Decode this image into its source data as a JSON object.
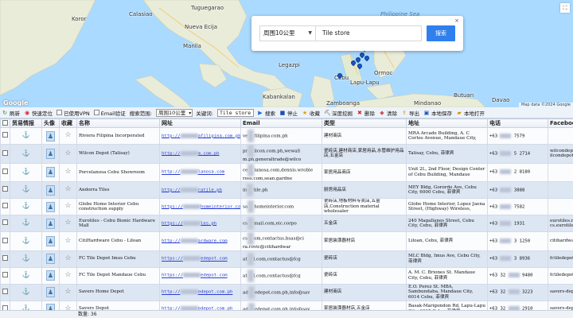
{
  "map": {
    "labels": [
      {
        "text": "Calasiao",
        "cls": ""
      },
      {
        "text": "Nueva Ecija",
        "cls": ""
      },
      {
        "text": "Tuguegarao",
        "cls": ""
      },
      {
        "text": "Philippine Sea",
        "cls": "sea"
      },
      {
        "text": "Manila",
        "cls": ""
      },
      {
        "text": "Legazpi",
        "cls": ""
      },
      {
        "text": "Ormoc",
        "cls": ""
      },
      {
        "text": "Cebu",
        "cls": ""
      },
      {
        "text": "Lapu-Lapu",
        "cls": ""
      },
      {
        "text": "Kabankalan",
        "cls": ""
      },
      {
        "text": "Butuan",
        "cls": ""
      },
      {
        "text": "Mindanao",
        "cls": ""
      },
      {
        "text": "Zamboanga",
        "cls": ""
      },
      {
        "text": "Davao",
        "cls": ""
      },
      {
        "text": "Koror",
        "cls": ""
      }
    ],
    "google_logo": "Google",
    "attribution": "Map data ©2024 Google"
  },
  "search_popup": {
    "radius": "周围10公里",
    "keyword": "Tile store",
    "search_button": "搜索",
    "close": "×"
  },
  "toolbar": {
    "refresh": "刷新",
    "quick_locate": "快速定位",
    "used_vpn": "已使用VPN",
    "email_verify": "Email验证",
    "search_range_label": "搜索范围:",
    "search_range_value": "周围10公里",
    "keyword_label": "关键词:",
    "keyword_value": "Tile store",
    "search": "搜索",
    "stop": "停止",
    "favorite": "收藏",
    "deep_dig": "深度挖掘",
    "delete": "删除",
    "clear": "清除",
    "export": "导出",
    "local_save": "本地保存",
    "local_open": "本地打开"
  },
  "table": {
    "headers": [
      "",
      "贸易情报",
      "头像",
      "收藏",
      "名称",
      "网址",
      "Email",
      "类型",
      "地址",
      "电话",
      "Facebook"
    ],
    "rows": [
      {
        "name": "Riviera Filipina Incorporated",
        "url_a": "http://",
        "url_b": "afilipina.com.ph",
        "email_a": "ve",
        "email_b": "filipina.com.ph",
        "type": "建材商店",
        "addr": "MRA Arcade Building, A. C Cortes Avenue, Mandaue City,",
        "ph_a": "+63",
        "ph_b": "7579",
        "fb": ""
      },
      {
        "name": "Wilcon Depot (Talisay)",
        "url_a": "http://",
        "url_b": "m.com.ph",
        "email_a": "pr",
        "email_b": "ilcon.com.ph,wewall m.ph,generaltrade@wilco",
        "type": "瓷砖店,建材商店,家居用品,水管维护用品店,五金店",
        "addr": "Talisay, Cebu, 菲律宾",
        "ph_a": "+63",
        "ph_b": "5 2714",
        "fb": "wilcondepot, ilcondepot"
      },
      {
        "name": "Porcelanosa Cebu Showroom",
        "url_a": "http://",
        "url_b": "lanosa.com",
        "email_a": "ce",
        "email_b": "lanosa.com,dennis.wroble ross.com,sean.gardne",
        "type": "家居用品商店",
        "addr": "Unit 2L, 2nd Floor, Design Center of Cebu Building, Mandaue",
        "ph_a": "+63",
        "ph_b": "2 8180",
        "fb": ""
      },
      {
        "name": "Andorra Tiles",
        "url_a": "http://",
        "url_b": "ratile.ph",
        "email_a": "in",
        "email_b": "tile.ph",
        "type": "厨房用品店",
        "addr": "MEY Bldg, Gorordo Ave, Cebu City, 6000 Cebu, 菲律宾",
        "ph_a": "+63",
        "ph_b": "3888",
        "fb": ""
      },
      {
        "name": "Globe Home Interior Cebu construction supply",
        "url_a": "https://",
        "url_b": "homeinterior.com",
        "email_a": "sa",
        "email_b": "homeinterior.com",
        "type": "瓷砖店,地板材料专卖店,五金店,Construction material wholesaler",
        "addr": "Globe Home Interior, Lopez Jaena Street, (Highway) Wireless,",
        "ph_a": "+63",
        "ph_b": "7582",
        "fb": ""
      },
      {
        "name": "Eurotiles - Cebu Bionic Hardware Mall",
        "url_a": "https://",
        "url_b": "les.ph",
        "email_a": "cs",
        "email_b": "mail.com,eic.corpo",
        "type": "五金店",
        "addr": "240 Magallanes Street, Cebu City, Cebu, 菲律宾",
        "ph_a": "+63",
        "ph_b": "1931",
        "fb": "eurotiles.mai cs.eurotiles"
      },
      {
        "name": "CitiHardware Cebu - Liloan",
        "url_a": "http://",
        "url_b": "ardware.com",
        "email_a": "cs",
        "email_b": "om,contactus.bsas@ci ra.rovic@citihardwar",
        "type": "家居装潢器材店",
        "addr": "Liloan, Cebu, 菲律宾",
        "ph_a": "+63",
        "ph_b": "3 1250",
        "fb": "citihardware hardware"
      },
      {
        "name": "FC Tile Depot Imus Cebu",
        "url_a": "https://",
        "url_b": "edepot.com",
        "email_a": "at",
        "email_b": "l.com,contactus@fcg",
        "type": "瓷砖店",
        "addr": "MLC Bldg, Imus Ave, Cebu City, 菲律宾",
        "ph_a": "+63",
        "ph_b": "3 8936",
        "fb": "fctiledepot"
      },
      {
        "name": "FC Tile Depot Mandaue Cebu",
        "url_a": "https://",
        "url_b": "edepot.com",
        "email_a": "at",
        "email_b": "l.com,contactus@fcg",
        "type": "瓷砖店",
        "addr": "A. M. C. Briones St. Mandaue City, Cebu, 菲律宾",
        "ph_a": "+63 32",
        "ph_b": "9480",
        "fb": "fctiledepot"
      },
      {
        "name": "Savers Home Depot",
        "url_a": "http://",
        "url_b": "edepot.com.ph",
        "email_a": "ad",
        "email_b": "edepot.com.ph,info@sav",
        "type": "建材商店",
        "addr": "E.O. Perez St. MBA, Sambundaba, Mandaue City, 6014 Cebu, 菲律宾",
        "ph_a": "+63 32",
        "ph_b": "3223",
        "fb": "savers-depot"
      },
      {
        "name": "Savers Depot",
        "url_a": "http://",
        "url_b": "edepot.com.ph",
        "email_a": "ad",
        "email_b": "edepot.com.ph,info@sav",
        "type": "家居装潢器材店,五金店",
        "addr": "Basak-Marigondon Rd, Lapu-Lapu City, 6015 Cebu, 菲律宾",
        "ph_a": "+63 32",
        "ph_b": "2910",
        "fb": "savers-depot"
      }
    ]
  },
  "status": {
    "count": "数量: 36"
  }
}
